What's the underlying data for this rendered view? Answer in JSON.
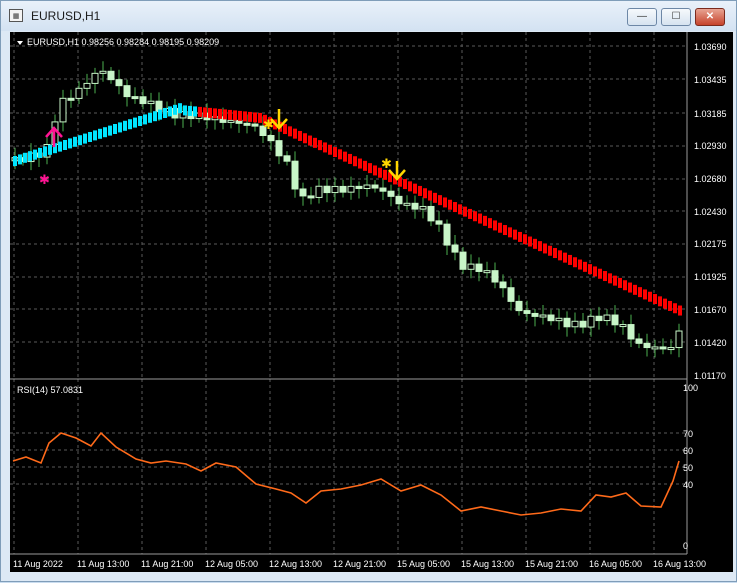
{
  "window": {
    "title": "EURUSD,H1",
    "buttons": {
      "minimize": "—",
      "maximize": "☐",
      "close": "✕"
    }
  },
  "chart": {
    "header": "EURUSD,H1  0.98256 0.98284 0.98195 0.98209",
    "price_ticks": [
      "1.03690",
      "1.03435",
      "1.03185",
      "1.02930",
      "1.02680",
      "1.02430",
      "1.02175",
      "1.01925",
      "1.01670",
      "1.01420",
      "1.01170"
    ],
    "time_ticks": [
      "11 Aug 2022",
      "11 Aug 13:00",
      "11 Aug 21:00",
      "12 Aug 05:00",
      "12 Aug 13:00",
      "12 Aug 21:00",
      "15 Aug 05:00",
      "15 Aug 13:00",
      "15 Aug 21:00",
      "16 Aug 05:00",
      "16 Aug 13:00"
    ]
  },
  "rsi": {
    "label": "RSI(14) 57.0831",
    "levels": [
      "100",
      "70",
      "60",
      "50",
      "40",
      "0"
    ]
  },
  "colors": {
    "background": "#000000",
    "grid": "#5a5a5a",
    "bull_candle": "#c8f5c8",
    "trend_up": "#00e5ff",
    "trend_down": "#ff0000",
    "arrow_up": "#ff1493",
    "arrow_down": "#ffd700",
    "rsi_line": "#ff6a1a"
  },
  "icons": {
    "up_arrow": "arrow-up-icon",
    "down_arrow": "arrow-down-icon",
    "star": "star-icon"
  }
}
